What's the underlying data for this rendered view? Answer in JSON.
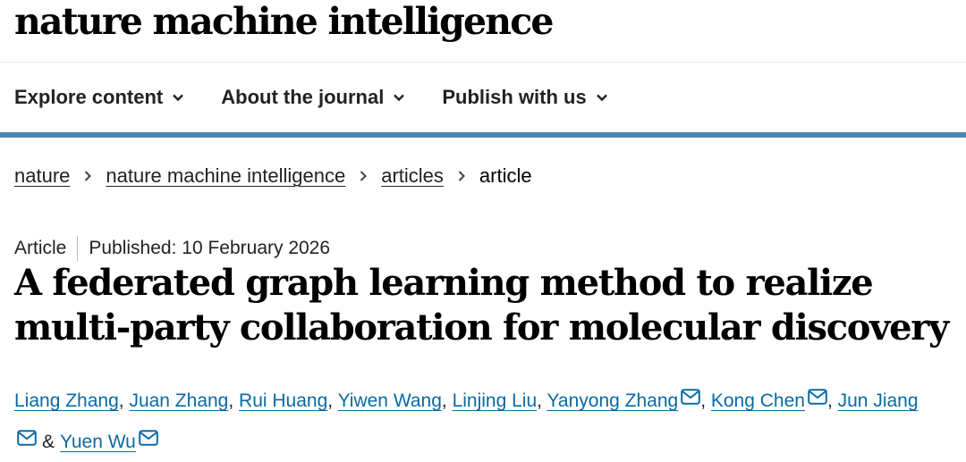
{
  "site": {
    "logo_text": "nature machine intelligence"
  },
  "nav": {
    "items": [
      {
        "label": "Explore content"
      },
      {
        "label": "About the journal"
      },
      {
        "label": "Publish with us"
      }
    ],
    "accent_color": "#4f87b0"
  },
  "breadcrumb": {
    "items": [
      {
        "label": "nature"
      },
      {
        "label": "nature machine intelligence"
      },
      {
        "label": "articles"
      }
    ],
    "current": "article"
  },
  "article": {
    "type": "Article",
    "published": "Published: 10 February 2026",
    "title": "A federated graph learning method to realize multi-party collaboration for molecular discovery",
    "authors": [
      {
        "name": "Liang Zhang",
        "sep": ", "
      },
      {
        "name": "Juan Zhang",
        "sep": ", "
      },
      {
        "name": "Rui Huang",
        "sep": ", "
      },
      {
        "name": "Yiwen Wang",
        "sep": ", "
      },
      {
        "name": "Linjing Liu",
        "sep": ", "
      },
      {
        "name": "Yanyong Zhang",
        "sep": ", "
      },
      {
        "name": "Kong Chen",
        "sep": ", "
      },
      {
        "name": "Jun Jiang",
        "sep": " & "
      },
      {
        "name": "Yuen Wu",
        "sep": ""
      }
    ],
    "link_color": "#0b6aa3"
  },
  "icons": [
    "chevron-down-icon",
    "chevron-right-icon",
    "mail-icon"
  ]
}
